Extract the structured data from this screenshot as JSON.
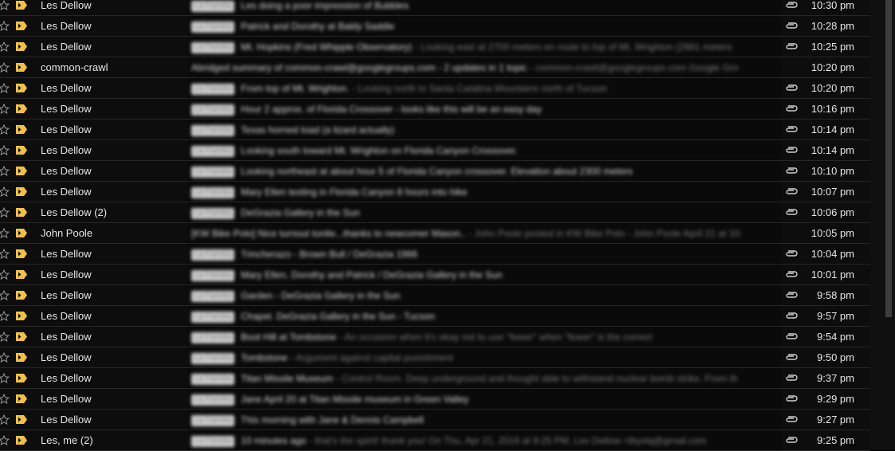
{
  "icons": {
    "star": "star-outline-icon",
    "marker": "importance-marker-icon",
    "attachment": "paperclip-icon"
  },
  "colors": {
    "marker": "#f2c144",
    "label_chip_bg": "#cfcfcf",
    "background": "#000000"
  },
  "messages": [
    {
      "sender": "Les Dellow",
      "label": "La Familia",
      "subject": "Les doing a poor impression of Bubbles",
      "snippet": "",
      "attachment": true,
      "time": "10:30 pm"
    },
    {
      "sender": "Les Dellow",
      "label": "La Familia",
      "subject": "Patrick and Dorothy at Baldy Saddle",
      "snippet": "",
      "attachment": true,
      "time": "10:28 pm"
    },
    {
      "sender": "Les Dellow",
      "label": "La Familia",
      "subject": "Mt. Hopkins (Fred Whipple Observatory)",
      "snippet": "- Looking east at 2700 meters en route to top of Mt. Wrighton (2881 meters",
      "attachment": true,
      "time": "10:25 pm"
    },
    {
      "sender": "common-crawl",
      "label": "",
      "subject": "Abridged summary of common-crawl@googlegroups.com - 2 updates in 1 topic",
      "snippet": "- common-crawl@googlegroups.com Google Gro",
      "attachment": false,
      "time": "10:20 pm"
    },
    {
      "sender": "Les Dellow",
      "label": "La Familia",
      "subject": "From top of Mt. Wrighton.",
      "snippet": "- Looking north to Santa Catalina Mountains north of Tucson",
      "attachment": true,
      "time": "10:20 pm"
    },
    {
      "sender": "Les Dellow",
      "label": "La Familia",
      "subject": "Hour 2 approx. of Florida Crossover - looks like this will be an easy day",
      "snippet": "",
      "attachment": true,
      "time": "10:16 pm"
    },
    {
      "sender": "Les Dellow",
      "label": "La Familia",
      "subject": "Texas horned toad (a lizard actually)",
      "snippet": "",
      "attachment": true,
      "time": "10:14 pm"
    },
    {
      "sender": "Les Dellow",
      "label": "La Familia",
      "subject": "Looking south toward Mt. Wrighton on Florida Canyon Crossover.",
      "snippet": "",
      "attachment": true,
      "time": "10:14 pm"
    },
    {
      "sender": "Les Dellow",
      "label": "La Familia",
      "subject": "Looking northeast at about hour 5 of Florida Canyon crossover. Elevation about 2300 meters",
      "snippet": "",
      "attachment": true,
      "time": "10:10 pm"
    },
    {
      "sender": "Les Dellow",
      "label": "La Familia",
      "subject": "Mary Ellen texting in Florida Canyon 8 hours into hike",
      "snippet": "",
      "attachment": true,
      "time": "10:07 pm"
    },
    {
      "sender": "Les Dellow (2)",
      "label": "La Familia",
      "subject": "DeGrazia Gallery in the Sun",
      "snippet": "",
      "attachment": true,
      "time": "10:06 pm"
    },
    {
      "sender": "John Poole",
      "label": "",
      "subject": "[KW Bike Polo] Nice turnout tonite...thanks to newcomer Mason..",
      "snippet": "- John Poole posted in KW Bike Polo - John Poole April 21 at 10:",
      "attachment": false,
      "time": "10:05 pm"
    },
    {
      "sender": "Les Dellow",
      "label": "La Familia",
      "subject": "Trincherazo - Brown Bull / DeGrazia 1966",
      "snippet": "",
      "attachment": true,
      "time": "10:04 pm"
    },
    {
      "sender": "Les Dellow",
      "label": "La Familia",
      "subject": "Mary Ellen, Dorothy and Patrick / DeGrazia Gallery in the Sun",
      "snippet": "",
      "attachment": true,
      "time": "10:01 pm"
    },
    {
      "sender": "Les Dellow",
      "label": "La Familia",
      "subject": "Garden - DeGrazia Gallery in the Sun",
      "snippet": "",
      "attachment": true,
      "time": "9:58 pm"
    },
    {
      "sender": "Les Dellow",
      "label": "La Familia",
      "subject": "Chapel. DeGrazia Gallery in the Sun - Tucson",
      "snippet": "",
      "attachment": true,
      "time": "9:57 pm"
    },
    {
      "sender": "Les Dellow",
      "label": "La Familia",
      "subject": "Boot Hill at Tombstone",
      "snippet": "- An occasion when it's okay not to use \"fewer\" when \"fewer\" is the correct",
      "attachment": true,
      "time": "9:54 pm"
    },
    {
      "sender": "Les Dellow",
      "label": "La Familia",
      "subject": "Tombstone",
      "snippet": "- Argument against capital punishment",
      "attachment": true,
      "time": "9:50 pm"
    },
    {
      "sender": "Les Dellow",
      "label": "La Familia",
      "subject": "Titan Missile Museum",
      "snippet": "- Control Room. Deep underground and thought able to withstand nuclear bomb strike. From th",
      "attachment": true,
      "time": "9:37 pm"
    },
    {
      "sender": "Les Dellow",
      "label": "La Familia",
      "subject": "Jane April 20 at Titan Missile museum in Green Valley",
      "snippet": "",
      "attachment": true,
      "time": "9:29 pm"
    },
    {
      "sender": "Les Dellow",
      "label": "La Familia",
      "subject": "This morning with Jane & Dennis Campbell",
      "snippet": "",
      "attachment": true,
      "time": "9:27 pm"
    },
    {
      "sender": "Les, me (2)",
      "label": "La Familia",
      "subject": "10 minutes ago",
      "snippet": "- that's the spirit! thank you! On Thu, Apr 21, 2016 at 9:25 PM, Les Dellow <lbyxlq@gmail.com",
      "attachment": true,
      "time": "9:25 pm"
    }
  ]
}
